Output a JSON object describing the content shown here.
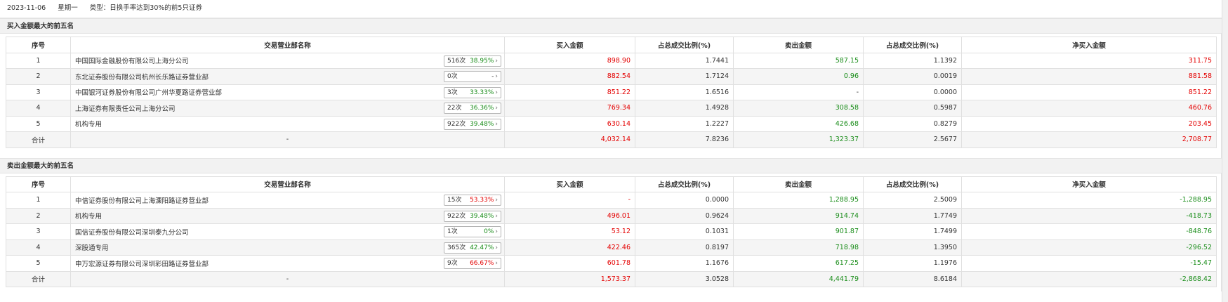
{
  "header": {
    "date": "2023-11-06",
    "weekday": "星期一",
    "type_label": "类型：日换手率达到30%的前5只证券"
  },
  "columns": [
    "序号",
    "交易营业部名称",
    "买入金额",
    "占总成交比例(%)",
    "卖出金额",
    "占总成交比例(%)",
    "净买入金额"
  ],
  "buy_section": {
    "title": "买入金额最大的前五名",
    "rows": [
      {
        "idx": "1",
        "name": "中国国际金融股份有限公司上海分公司",
        "count": "516次",
        "pct": "38.95%",
        "pct_color": "green",
        "buy": "898.90",
        "buy_ratio": "1.7441",
        "sell": "587.15",
        "sell_ratio": "1.1392",
        "net": "311.75",
        "net_color": "red"
      },
      {
        "idx": "2",
        "name": "东北证券股份有限公司杭州长乐路证券营业部",
        "count": "0次",
        "pct": "-",
        "pct_color": "neutral",
        "buy": "882.54",
        "buy_ratio": "1.7124",
        "sell": "0.96",
        "sell_ratio": "0.0019",
        "net": "881.58",
        "net_color": "red"
      },
      {
        "idx": "3",
        "name": "中国银河证券股份有限公司广州华夏路证券营业部",
        "count": "3次",
        "pct": "33.33%",
        "pct_color": "green",
        "buy": "851.22",
        "buy_ratio": "1.6516",
        "sell": "-",
        "sell_ratio": "0.0000",
        "net": "851.22",
        "net_color": "red"
      },
      {
        "idx": "4",
        "name": "上海证券有限责任公司上海分公司",
        "count": "22次",
        "pct": "36.36%",
        "pct_color": "green",
        "buy": "769.34",
        "buy_ratio": "1.4928",
        "sell": "308.58",
        "sell_ratio": "0.5987",
        "net": "460.76",
        "net_color": "red"
      },
      {
        "idx": "5",
        "name": "机构专用",
        "count": "922次",
        "pct": "39.48%",
        "pct_color": "green",
        "buy": "630.14",
        "buy_ratio": "1.2227",
        "sell": "426.68",
        "sell_ratio": "0.8279",
        "net": "203.45",
        "net_color": "red"
      }
    ],
    "total": {
      "label": "合计",
      "name": "-",
      "buy": "4,032.14",
      "buy_ratio": "7.8236",
      "sell": "1,323.37",
      "sell_ratio": "2.5677",
      "net": "2,708.77",
      "net_color": "red"
    }
  },
  "sell_section": {
    "title": "卖出金额最大的前五名",
    "rows": [
      {
        "idx": "1",
        "name": "中信证券股份有限公司上海溧阳路证券营业部",
        "count": "15次",
        "pct": "53.33%",
        "pct_color": "red",
        "buy": "-",
        "buy_ratio": "0.0000",
        "sell": "1,288.95",
        "sell_ratio": "2.5009",
        "net": "-1,288.95",
        "net_color": "green"
      },
      {
        "idx": "2",
        "name": "机构专用",
        "count": "922次",
        "pct": "39.48%",
        "pct_color": "green",
        "buy": "496.01",
        "buy_ratio": "0.9624",
        "sell": "914.74",
        "sell_ratio": "1.7749",
        "net": "-418.73",
        "net_color": "green"
      },
      {
        "idx": "3",
        "name": "国信证券股份有限公司深圳泰九分公司",
        "count": "1次",
        "pct": "0%",
        "pct_color": "green",
        "buy": "53.12",
        "buy_ratio": "0.1031",
        "sell": "901.87",
        "sell_ratio": "1.7499",
        "net": "-848.76",
        "net_color": "green"
      },
      {
        "idx": "4",
        "name": "深股通专用",
        "count": "365次",
        "pct": "42.47%",
        "pct_color": "green",
        "buy": "422.46",
        "buy_ratio": "0.8197",
        "sell": "718.98",
        "sell_ratio": "1.3950",
        "net": "-296.52",
        "net_color": "green"
      },
      {
        "idx": "5",
        "name": "申万宏源证券有限公司深圳彩田路证券营业部",
        "count": "9次",
        "pct": "66.67%",
        "pct_color": "red",
        "buy": "601.78",
        "buy_ratio": "1.1676",
        "sell": "617.25",
        "sell_ratio": "1.1976",
        "net": "-15.47",
        "net_color": "green"
      }
    ],
    "total": {
      "label": "合计",
      "name": "-",
      "buy": "1,573.37",
      "buy_ratio": "3.0528",
      "sell": "4,441.79",
      "sell_ratio": "8.6184",
      "net": "-2,868.42",
      "net_color": "green"
    }
  },
  "colors": {
    "up": "#e40000",
    "down": "#1a8d1a",
    "header_bg": "#f2f2f2",
    "alt_row": "#f5f5f5"
  }
}
